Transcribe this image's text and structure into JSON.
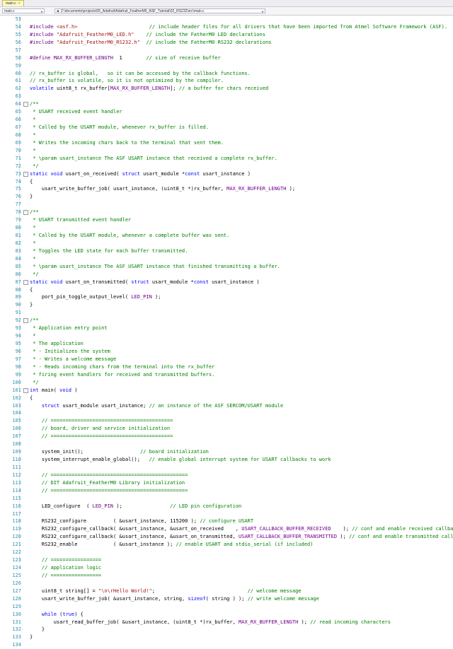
{
  "tab": {
    "label": "main.c",
    "close": "×"
  },
  "nav": {
    "left_combo": "main.c",
    "path_combo": "Z:\\documents\\projects\\05_Adafruit\\Adafruit_FeatherM0_ASF_Tutorial\\02_RS232\\src\\main.c"
  },
  "lines": [
    {
      "n": "53",
      "fold": "",
      "t": []
    },
    {
      "n": "54",
      "fold": "",
      "t": [
        [
          "m",
          "#include "
        ],
        [
          "s",
          "<asf.h>"
        ],
        [
          "p",
          "                        "
        ],
        [
          "c",
          "// include header files for all drivers that have been imported from Atmel Software Framework (ASF)."
        ]
      ]
    },
    {
      "n": "55",
      "fold": "",
      "t": [
        [
          "m",
          "#include "
        ],
        [
          "s",
          "\"Adafruit_FeatherM0_LED.h\""
        ],
        [
          "p",
          "    "
        ],
        [
          "c",
          "// include the FatherM0 LED declarations"
        ]
      ]
    },
    {
      "n": "56",
      "fold": "",
      "t": [
        [
          "m",
          "#include "
        ],
        [
          "s",
          "\"Adafruit_FeatherM0_RS232.h\""
        ],
        [
          "p",
          "  "
        ],
        [
          "c",
          "// include the FatherM0 RS232 declarations"
        ]
      ]
    },
    {
      "n": "57",
      "fold": "",
      "t": []
    },
    {
      "n": "58",
      "fold": "",
      "t": [
        [
          "m",
          "#define "
        ],
        [
          "m",
          "MAX_RX_BUFFER_LENGTH"
        ],
        [
          "p",
          "  1        "
        ],
        [
          "c",
          "// size of receive buffer"
        ]
      ]
    },
    {
      "n": "59",
      "fold": "",
      "t": []
    },
    {
      "n": "60",
      "fold": "",
      "t": [
        [
          "c",
          "// rx_buffer is global,   so it can be accessed by the callback functions."
        ]
      ]
    },
    {
      "n": "61",
      "fold": "",
      "t": [
        [
          "c",
          "// rx_buffer is volatile, so it is not optimized by the compiler."
        ]
      ]
    },
    {
      "n": "62",
      "fold": "",
      "t": [
        [
          "k",
          "volatile "
        ],
        [
          "p",
          "uint8_t rx_buffer["
        ],
        [
          "m",
          "MAX_RX_BUFFER_LENGTH"
        ],
        [
          "p",
          "]; "
        ],
        [
          "c",
          "// a buffer for chars received"
        ]
      ]
    },
    {
      "n": "63",
      "fold": "",
      "t": []
    },
    {
      "n": "64",
      "fold": "-",
      "t": [
        [
          "c",
          "/**"
        ]
      ]
    },
    {
      "n": "65",
      "fold": "",
      "t": [
        [
          "c",
          " * USART received event handler"
        ]
      ]
    },
    {
      "n": "66",
      "fold": "",
      "t": [
        [
          "c",
          " *"
        ]
      ]
    },
    {
      "n": "67",
      "fold": "",
      "t": [
        [
          "c",
          " * Called by the USART module, whenever rx_buffer is filled."
        ]
      ]
    },
    {
      "n": "68",
      "fold": "",
      "t": [
        [
          "c",
          " *"
        ]
      ]
    },
    {
      "n": "69",
      "fold": "",
      "t": [
        [
          "c",
          " * Writes the incoming chars back to the terminal that sent them."
        ]
      ]
    },
    {
      "n": "70",
      "fold": "",
      "t": [
        [
          "c",
          " *"
        ]
      ]
    },
    {
      "n": "71",
      "fold": "",
      "t": [
        [
          "c",
          " * \\param usart_instance The ASF USART instance that received a complete rx_buffer."
        ]
      ]
    },
    {
      "n": "72",
      "fold": "",
      "t": [
        [
          "c",
          " */"
        ]
      ]
    },
    {
      "n": "73",
      "fold": "-",
      "t": [
        [
          "k",
          "static void "
        ],
        [
          "p",
          "usart_on_received( "
        ],
        [
          "k",
          "struct "
        ],
        [
          "p",
          "usart_module *"
        ],
        [
          "k",
          "const "
        ],
        [
          "p",
          "usart_instance )"
        ]
      ]
    },
    {
      "n": "74",
      "fold": "",
      "t": [
        [
          "p",
          "{"
        ]
      ]
    },
    {
      "n": "75",
      "fold": "",
      "t": [
        [
          "p",
          "    usart_write_buffer_job( usart_instance, (uint8_t *)rx_buffer, "
        ],
        [
          "m",
          "MAX_RX_BUFFER_LENGTH"
        ],
        [
          "p",
          " );"
        ]
      ]
    },
    {
      "n": "76",
      "fold": "",
      "t": [
        [
          "p",
          "}"
        ]
      ]
    },
    {
      "n": "77",
      "fold": "",
      "t": []
    },
    {
      "n": "78",
      "fold": "-",
      "t": [
        [
          "c",
          "/**"
        ]
      ]
    },
    {
      "n": "79",
      "fold": "",
      "t": [
        [
          "c",
          " * USART transmitted event handler"
        ]
      ]
    },
    {
      "n": "80",
      "fold": "",
      "t": [
        [
          "c",
          " *"
        ]
      ]
    },
    {
      "n": "81",
      "fold": "",
      "t": [
        [
          "c",
          " * Called by the USART module, whenever a complete buffer was sent."
        ]
      ]
    },
    {
      "n": "82",
      "fold": "",
      "t": [
        [
          "c",
          " *"
        ]
      ]
    },
    {
      "n": "83",
      "fold": "",
      "t": [
        [
          "c",
          " * Toggles the LED state for each buffer transmitted."
        ]
      ]
    },
    {
      "n": "84",
      "fold": "",
      "t": [
        [
          "c",
          " *"
        ]
      ]
    },
    {
      "n": "85",
      "fold": "",
      "t": [
        [
          "c",
          " * \\param usart_instance The ASF USART instance that finished transmitting a buffer."
        ]
      ]
    },
    {
      "n": "86",
      "fold": "",
      "t": [
        [
          "c",
          " */"
        ]
      ]
    },
    {
      "n": "87",
      "fold": "-",
      "t": [
        [
          "k",
          "static void "
        ],
        [
          "p",
          "usart_on_transmitted( "
        ],
        [
          "k",
          "struct "
        ],
        [
          "p",
          "usart_module *"
        ],
        [
          "k",
          "const "
        ],
        [
          "p",
          "usart_instance )"
        ]
      ]
    },
    {
      "n": "88",
      "fold": "",
      "t": [
        [
          "p",
          "{"
        ]
      ]
    },
    {
      "n": "89",
      "fold": "",
      "t": [
        [
          "p",
          "    port_pin_toggle_output_level( "
        ],
        [
          "m",
          "LED_PIN"
        ],
        [
          "p",
          " );"
        ]
      ]
    },
    {
      "n": "90",
      "fold": "",
      "t": [
        [
          "p",
          "}"
        ]
      ]
    },
    {
      "n": "91",
      "fold": "",
      "t": []
    },
    {
      "n": "92",
      "fold": "-",
      "t": [
        [
          "c",
          "/**"
        ]
      ]
    },
    {
      "n": "93",
      "fold": "",
      "t": [
        [
          "c",
          " * Application entry point"
        ]
      ]
    },
    {
      "n": "94",
      "fold": "",
      "t": [
        [
          "c",
          " *"
        ]
      ]
    },
    {
      "n": "95",
      "fold": "",
      "t": [
        [
          "c",
          " * The application"
        ]
      ]
    },
    {
      "n": "96",
      "fold": "",
      "t": [
        [
          "c",
          " * - Initializes the system"
        ]
      ]
    },
    {
      "n": "97",
      "fold": "",
      "t": [
        [
          "c",
          " * - Writes a welcome message"
        ]
      ]
    },
    {
      "n": "98",
      "fold": "",
      "t": [
        [
          "c",
          " * - Reads incoming chars from the terminal into the rx_buffer"
        ]
      ]
    },
    {
      "n": "99",
      "fold": "",
      "t": [
        [
          "c",
          " * firing event handlers for received and transmitted buffers."
        ]
      ]
    },
    {
      "n": "100",
      "fold": "",
      "t": [
        [
          "c",
          " */"
        ]
      ]
    },
    {
      "n": "101",
      "fold": "-",
      "t": [
        [
          "k",
          "int "
        ],
        [
          "p",
          "main( "
        ],
        [
          "k",
          "void"
        ],
        [
          "p",
          " )"
        ]
      ]
    },
    {
      "n": "102",
      "fold": "",
      "t": [
        [
          "p",
          "{"
        ]
      ]
    },
    {
      "n": "103",
      "fold": "",
      "t": [
        [
          "p",
          "    "
        ],
        [
          "k",
          "struct "
        ],
        [
          "p",
          "usart_module usart_instance; "
        ],
        [
          "c",
          "// an instance of the ASF SERCOM/USART module"
        ]
      ]
    },
    {
      "n": "104",
      "fold": "",
      "t": []
    },
    {
      "n": "105",
      "fold": "",
      "t": [
        [
          "c",
          "    // ========================================="
        ]
      ]
    },
    {
      "n": "106",
      "fold": "",
      "t": [
        [
          "c",
          "    // board, driver and service initialization"
        ]
      ]
    },
    {
      "n": "107",
      "fold": "",
      "t": [
        [
          "c",
          "    // ========================================="
        ]
      ]
    },
    {
      "n": "108",
      "fold": "",
      "t": []
    },
    {
      "n": "109",
      "fold": "",
      "t": [
        [
          "p",
          "    system_init();                   "
        ],
        [
          "c",
          "// board initialization"
        ]
      ]
    },
    {
      "n": "110",
      "fold": "",
      "t": [
        [
          "p",
          "    system_interrupt_enable_global();   "
        ],
        [
          "c",
          "// enable global interrupt system for USART callbacks to work"
        ]
      ]
    },
    {
      "n": "111",
      "fold": "",
      "t": []
    },
    {
      "n": "112",
      "fold": "",
      "t": [
        [
          "c",
          "    // =============================================="
        ]
      ]
    },
    {
      "n": "113",
      "fold": "",
      "t": [
        [
          "c",
          "    // DIT Adafruit_FeatherM0 Library initialization"
        ]
      ]
    },
    {
      "n": "114",
      "fold": "",
      "t": [
        [
          "c",
          "    // =============================================="
        ]
      ]
    },
    {
      "n": "115",
      "fold": "",
      "t": []
    },
    {
      "n": "116",
      "fold": "",
      "t": [
        [
          "p",
          "    LED_configure  ( "
        ],
        [
          "m",
          "LED_PIN"
        ],
        [
          "p",
          " );                "
        ],
        [
          "c",
          "// LED pin configuration"
        ]
      ]
    },
    {
      "n": "117",
      "fold": "",
      "t": []
    },
    {
      "n": "118",
      "fold": "",
      "t": [
        [
          "p",
          "    RS232_configure         ( &usart_instance, 115200 ); "
        ],
        [
          "c",
          "// configure USART"
        ]
      ]
    },
    {
      "n": "119",
      "fold": "",
      "t": [
        [
          "p",
          "    RS232_configure_callback( &usart_instance, &usart_on_received    , "
        ],
        [
          "m",
          "USART_CALLBACK_BUFFER_RECEIVED"
        ],
        [
          "p",
          "    ); "
        ],
        [
          "c",
          "// conf and enable received callback"
        ]
      ]
    },
    {
      "n": "120",
      "fold": "",
      "t": [
        [
          "p",
          "    RS232_configure_callback( &usart_instance, &usart_on_transmitted, "
        ],
        [
          "m",
          "USART_CALLBACK_BUFFER_TRANSMITTED"
        ],
        [
          "p",
          " ); "
        ],
        [
          "c",
          "// conf and enable transmitted callback"
        ]
      ]
    },
    {
      "n": "121",
      "fold": "",
      "t": [
        [
          "p",
          "    RS232_enable            ( &usart_instance ); "
        ],
        [
          "c",
          "// enable USART and stdio_serial (if included)"
        ]
      ]
    },
    {
      "n": "122",
      "fold": "",
      "t": []
    },
    {
      "n": "123",
      "fold": "",
      "t": [
        [
          "c",
          "    // ================="
        ]
      ]
    },
    {
      "n": "124",
      "fold": "",
      "t": [
        [
          "c",
          "    // application logic"
        ]
      ]
    },
    {
      "n": "125",
      "fold": "",
      "t": [
        [
          "c",
          "    // ================="
        ]
      ]
    },
    {
      "n": "126",
      "fold": "",
      "t": []
    },
    {
      "n": "127",
      "fold": "",
      "t": [
        [
          "p",
          "    uint8_t string[] = "
        ],
        [
          "s",
          "\"\\n\\rHello World!\""
        ],
        [
          "p",
          ";                               "
        ],
        [
          "c",
          "// welcome message"
        ]
      ]
    },
    {
      "n": "128",
      "fold": "",
      "t": [
        [
          "p",
          "    usart_write_buffer_job( &usart_instance, string, "
        ],
        [
          "k",
          "sizeof"
        ],
        [
          "p",
          "( string ) ); "
        ],
        [
          "c",
          "// write welcome message"
        ]
      ]
    },
    {
      "n": "129",
      "fold": "",
      "t": []
    },
    {
      "n": "130",
      "fold": "",
      "t": [
        [
          "p",
          "    "
        ],
        [
          "k",
          "while "
        ],
        [
          "p",
          "("
        ],
        [
          "k",
          "true"
        ],
        [
          "p",
          ") {"
        ]
      ]
    },
    {
      "n": "131",
      "fold": "",
      "t": [
        [
          "p",
          "        usart_read_buffer_job( &usart_instance, (uint8_t *)rx_buffer, "
        ],
        [
          "m",
          "MAX_RX_BUFFER_LENGTH"
        ],
        [
          "p",
          " ); "
        ],
        [
          "c",
          "// read incoming characters"
        ]
      ]
    },
    {
      "n": "132",
      "fold": "",
      "t": [
        [
          "p",
          "    }"
        ]
      ]
    },
    {
      "n": "133",
      "fold": "",
      "t": [
        [
          "p",
          "}"
        ]
      ]
    },
    {
      "n": "134",
      "fold": "",
      "t": []
    }
  ]
}
